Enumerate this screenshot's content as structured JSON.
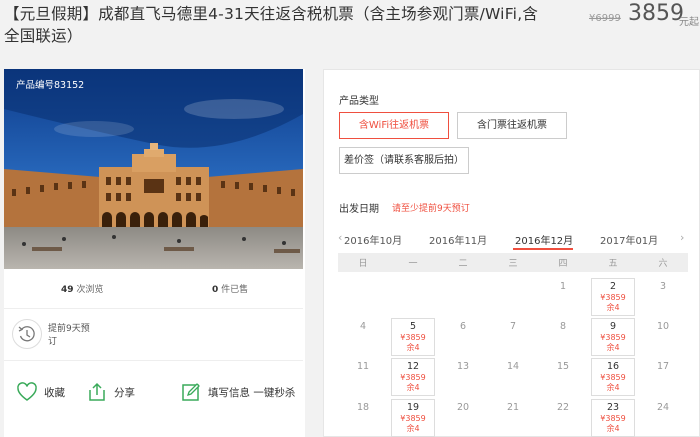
{
  "header": {
    "title": "【元旦假期】成都直飞马德里4-31天往返含税机票（含主场参观门票/WiFi,含全国联运）",
    "old_price": "¥6999",
    "price": "3859",
    "price_unit": "元起"
  },
  "product": {
    "id_label": "产品编号83152",
    "views_count": "49",
    "views_label": "次浏览",
    "sold_count": "0",
    "sold_label": "件已售",
    "advance_note": "提前9天预订",
    "actions": {
      "favorite": "收藏",
      "share": "分享",
      "book": "填写信息 一键秒杀"
    }
  },
  "booking": {
    "type_label": "产品类型",
    "options": [
      "含WiFi往返机票",
      "含门票往返机票",
      "差价签（请联系客服后拍）"
    ],
    "selected_option": 0,
    "date_label": "出发日期",
    "date_hint": "请至少提前9天预订",
    "months": [
      "2016年10月",
      "2016年11月",
      "2016年12月",
      "2017年01月"
    ],
    "active_month": 2,
    "weekdays": [
      "日",
      "一",
      "二",
      "三",
      "四",
      "五",
      "六"
    ],
    "calendar": [
      {
        "day": "1",
        "col": 4,
        "row": 0
      },
      {
        "day": "2",
        "col": 5,
        "row": 0,
        "price": "¥3859",
        "stock": "余4"
      },
      {
        "day": "3",
        "col": 6,
        "row": 0
      },
      {
        "day": "4",
        "col": 0,
        "row": 1
      },
      {
        "day": "5",
        "col": 1,
        "row": 1,
        "price": "¥3859",
        "stock": "余4"
      },
      {
        "day": "6",
        "col": 2,
        "row": 1
      },
      {
        "day": "7",
        "col": 3,
        "row": 1
      },
      {
        "day": "8",
        "col": 4,
        "row": 1
      },
      {
        "day": "9",
        "col": 5,
        "row": 1,
        "price": "¥3859",
        "stock": "余4"
      },
      {
        "day": "10",
        "col": 6,
        "row": 1
      },
      {
        "day": "11",
        "col": 0,
        "row": 2
      },
      {
        "day": "12",
        "col": 1,
        "row": 2,
        "price": "¥3859",
        "stock": "余4"
      },
      {
        "day": "13",
        "col": 2,
        "row": 2
      },
      {
        "day": "14",
        "col": 3,
        "row": 2
      },
      {
        "day": "15",
        "col": 4,
        "row": 2
      },
      {
        "day": "16",
        "col": 5,
        "row": 2,
        "price": "¥3859",
        "stock": "余4"
      },
      {
        "day": "17",
        "col": 6,
        "row": 2
      },
      {
        "day": "18",
        "col": 0,
        "row": 3
      },
      {
        "day": "19",
        "col": 1,
        "row": 3,
        "price": "¥3859",
        "stock": "余4"
      },
      {
        "day": "20",
        "col": 2,
        "row": 3
      },
      {
        "day": "21",
        "col": 3,
        "row": 3
      },
      {
        "day": "22",
        "col": 4,
        "row": 3
      },
      {
        "day": "23",
        "col": 5,
        "row": 3,
        "price": "¥3859",
        "stock": "余4"
      },
      {
        "day": "24",
        "col": 6,
        "row": 3
      }
    ]
  },
  "colors": {
    "accent": "#ef4f3f",
    "sky": "#1c4f9c",
    "building": "#c8894a"
  }
}
